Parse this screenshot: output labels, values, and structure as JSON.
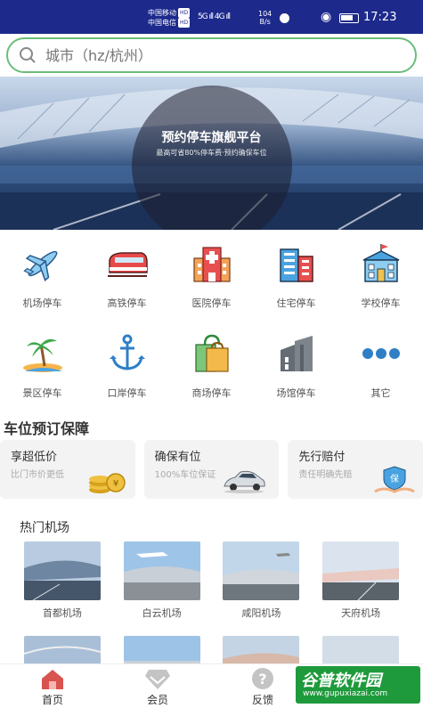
{
  "status_bar": {
    "carrier1": "中国移动",
    "carrier2": "中国电信",
    "hd": "HD",
    "signal": "5G ıll 4G ıll",
    "speed_value": "104",
    "speed_unit": "B/s",
    "time": "17:23"
  },
  "search": {
    "placeholder": "城市（hz/杭州）"
  },
  "banner": {
    "title": "预约停车旗舰平台",
    "subtitle": "最高可省80%停车费·预约确保车位"
  },
  "categories": [
    {
      "label": "机场停车",
      "icon": "airplane-icon"
    },
    {
      "label": "高铁停车",
      "icon": "train-icon"
    },
    {
      "label": "医院停车",
      "icon": "hospital-icon"
    },
    {
      "label": "住宅停车",
      "icon": "residence-icon"
    },
    {
      "label": "学校停车",
      "icon": "school-icon"
    },
    {
      "label": "景区停车",
      "icon": "scenic-island-icon"
    },
    {
      "label": "口岸停车",
      "icon": "anchor-icon"
    },
    {
      "label": "商场停车",
      "icon": "shopping-bag-icon"
    },
    {
      "label": "场馆停车",
      "icon": "stadium-icon"
    },
    {
      "label": "其它",
      "icon": "more-dots-icon"
    }
  ],
  "guarantee": {
    "title": "车位预订保障",
    "items": [
      {
        "title": "享超低价",
        "subtitle": "比门市价更低",
        "icon": "coins-icon"
      },
      {
        "title": "确保有位",
        "subtitle": "100%车位保证",
        "icon": "car-icon"
      },
      {
        "title": "先行赔付",
        "subtitle": "责任明确先赔",
        "icon": "shield-hand-icon"
      }
    ]
  },
  "hot_airports": {
    "title": "热门机场",
    "items": [
      {
        "name": "首都机场"
      },
      {
        "name": "白云机场"
      },
      {
        "name": "咸阳机场"
      },
      {
        "name": "天府机场"
      }
    ]
  },
  "tabs": [
    {
      "label": "首页",
      "icon": "home-icon",
      "color": "#d9534f"
    },
    {
      "label": "会员",
      "icon": "member-diamond-icon",
      "color": "#bbbbbb"
    },
    {
      "label": "反馈",
      "icon": "feedback-question-icon",
      "color": "#bbbbbb"
    }
  ],
  "watermark": {
    "text": "谷普软件园",
    "url": "www.gupuxiazai.com"
  },
  "colors": {
    "status_bar": "#1d2a8c",
    "search_border": "#6bbd7a",
    "watermark": "#1e9a3c"
  }
}
